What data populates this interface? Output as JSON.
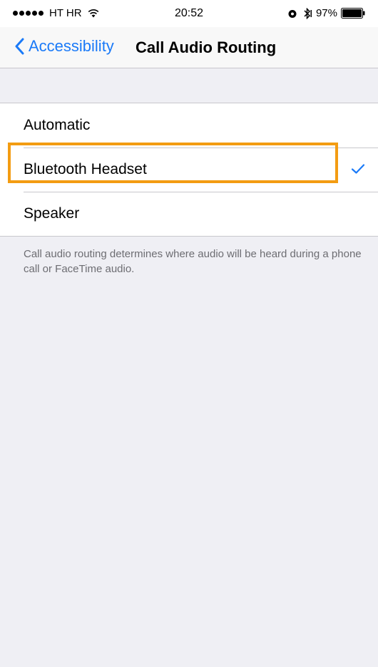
{
  "status_bar": {
    "carrier": "HT HR",
    "time": "20:52",
    "battery_percent": "97%"
  },
  "nav": {
    "back_label": "Accessibility",
    "title": "Call Audio Routing"
  },
  "options": [
    {
      "label": "Automatic",
      "selected": false
    },
    {
      "label": "Bluetooth Headset",
      "selected": true
    },
    {
      "label": "Speaker",
      "selected": false
    }
  ],
  "footer": {
    "text": "Call audio routing determines where audio will be heard during a phone call or FaceTime audio."
  },
  "colors": {
    "accent": "#1a7af8",
    "highlight": "#f39c12",
    "background": "#efeff4"
  },
  "icons": [
    "wifi-icon",
    "alarm-icon",
    "bluetooth-icon",
    "battery-icon",
    "chevron-left-icon",
    "checkmark-icon"
  ]
}
